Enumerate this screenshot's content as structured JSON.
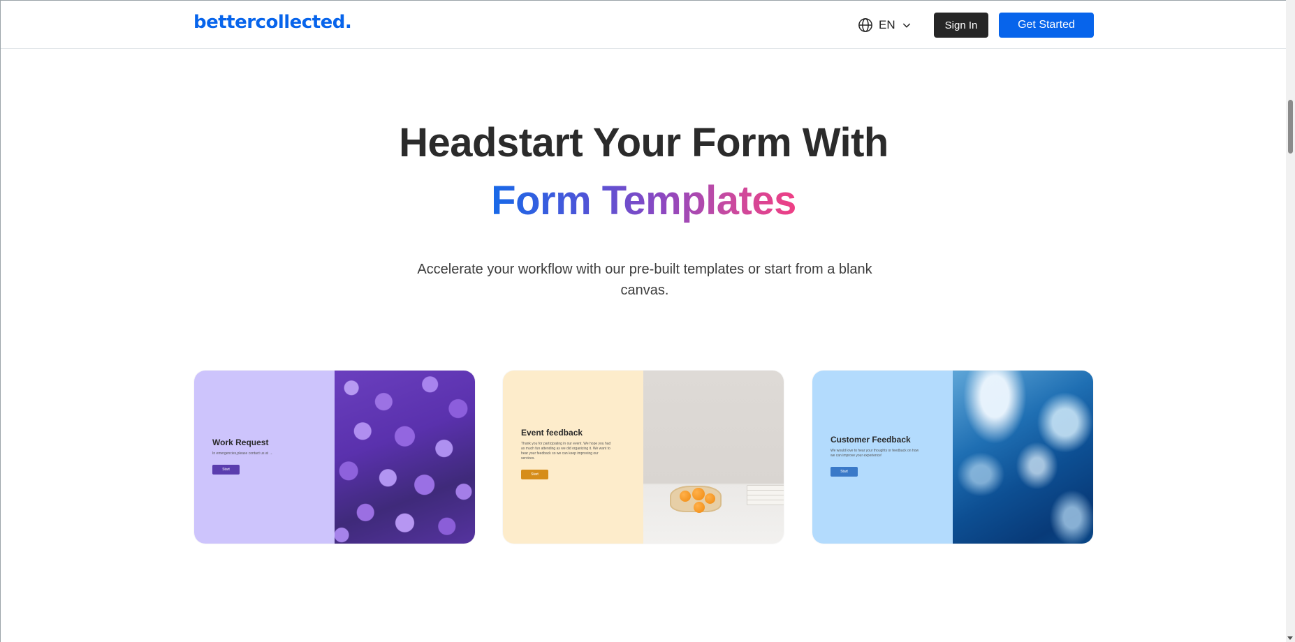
{
  "nav": {
    "logo": "bettercollected.",
    "language": "EN",
    "language_icon": "globe-icon",
    "dropdown_icon": "chevron-down-icon",
    "sign_in": "Sign In",
    "get_started": "Get Started"
  },
  "hero": {
    "title_line1": "Headstart Your Form With",
    "title_line2": "Form Templates",
    "subtitle": "Accelerate your workflow with our pre-built templates or start from a blank canvas."
  },
  "templates": [
    {
      "title": "Work Request",
      "description": "In emergencies,please contact us at →",
      "button": "Start",
      "color": "#cdc4fc",
      "image": "purple-flowers"
    },
    {
      "title": "Event feedback",
      "description": "Thank you for participating in our event. We hope you had as much fun attending as we did organizing it. We want to hear your feedback so we can keep improving our services.",
      "button": "Start",
      "color": "#fdeccb",
      "image": "fruit-and-books"
    },
    {
      "title": "Customer Feedback",
      "description": "We would love to hear your thoughts or feedback on how we can improve your experience!",
      "button": "Start",
      "color": "#b3dbfd",
      "image": "ocean-waves"
    }
  ],
  "colors": {
    "brand": "#0764eb",
    "dark_button": "#262626"
  }
}
